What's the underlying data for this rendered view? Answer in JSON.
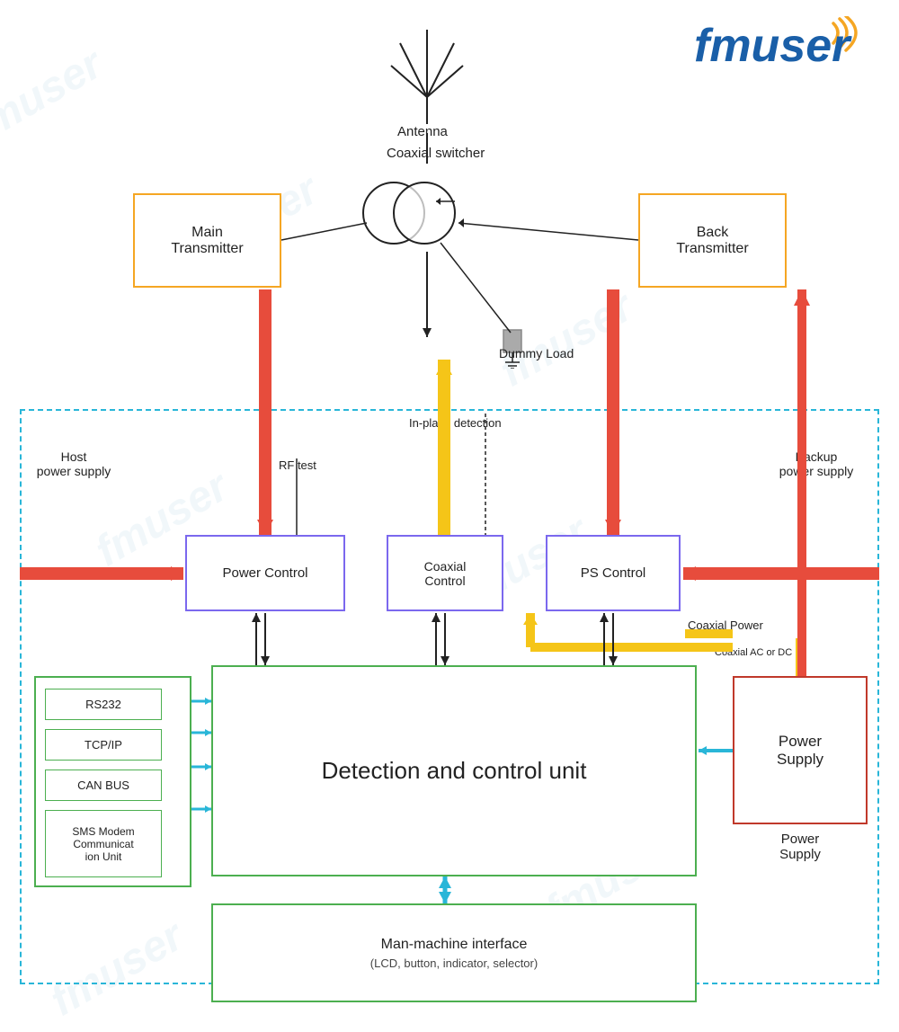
{
  "logo": {
    "text": "fmuser",
    "signal_color": "#f5a623"
  },
  "diagram": {
    "antenna_label": "Antenna",
    "coaxial_switcher_label": "Coaxial switcher",
    "dummy_load_label": "Dummy Load",
    "main_transmitter_label": "Main\nTransmitter",
    "back_transmitter_label": "Back\nTransmitter",
    "host_power_label": "Host\npower supply",
    "backup_power_label": "Backup\npower supply",
    "rf_test_label": "RF test",
    "in_place_label": "In-place detection",
    "power_control_label": "Power Control",
    "coaxial_control_label": "Coaxial\nControl",
    "ps_control_label": "PS Control",
    "coaxial_power_label": "Coaxial Power",
    "coaxial_ac_dc_label": "Coaxial AC or DC",
    "detection_unit_label": "Detection and control unit",
    "power_supply_label": "Power\nSupply",
    "power_supply_bottom_label": "Power\nSupply",
    "comm_items": [
      "RS232",
      "TCP/IP",
      "CAN BUS",
      "SMS Modem\nCommunicat\nion Unit"
    ],
    "hmi_label": "Man-machine interface",
    "hmi_sublabel": "(LCD, button, indicator, selector)",
    "watermarks": [
      "fmuser",
      "fmuser",
      "fmuser",
      "fmuser",
      "fmuser",
      "fmuser",
      "fmuser",
      "fmuser"
    ]
  },
  "colors": {
    "orange": "#f5a623",
    "purple": "#7b68ee",
    "green": "#4caf50",
    "red": "#e74c3c",
    "blue_dashed": "#29b6d8",
    "yellow": "#f5c518",
    "dark_red": "#c0392b",
    "cyan": "#29b6d8",
    "black": "#222222",
    "logo_blue": "#1a5fa8",
    "watermark_color": "rgba(180,210,230,0.18)"
  }
}
